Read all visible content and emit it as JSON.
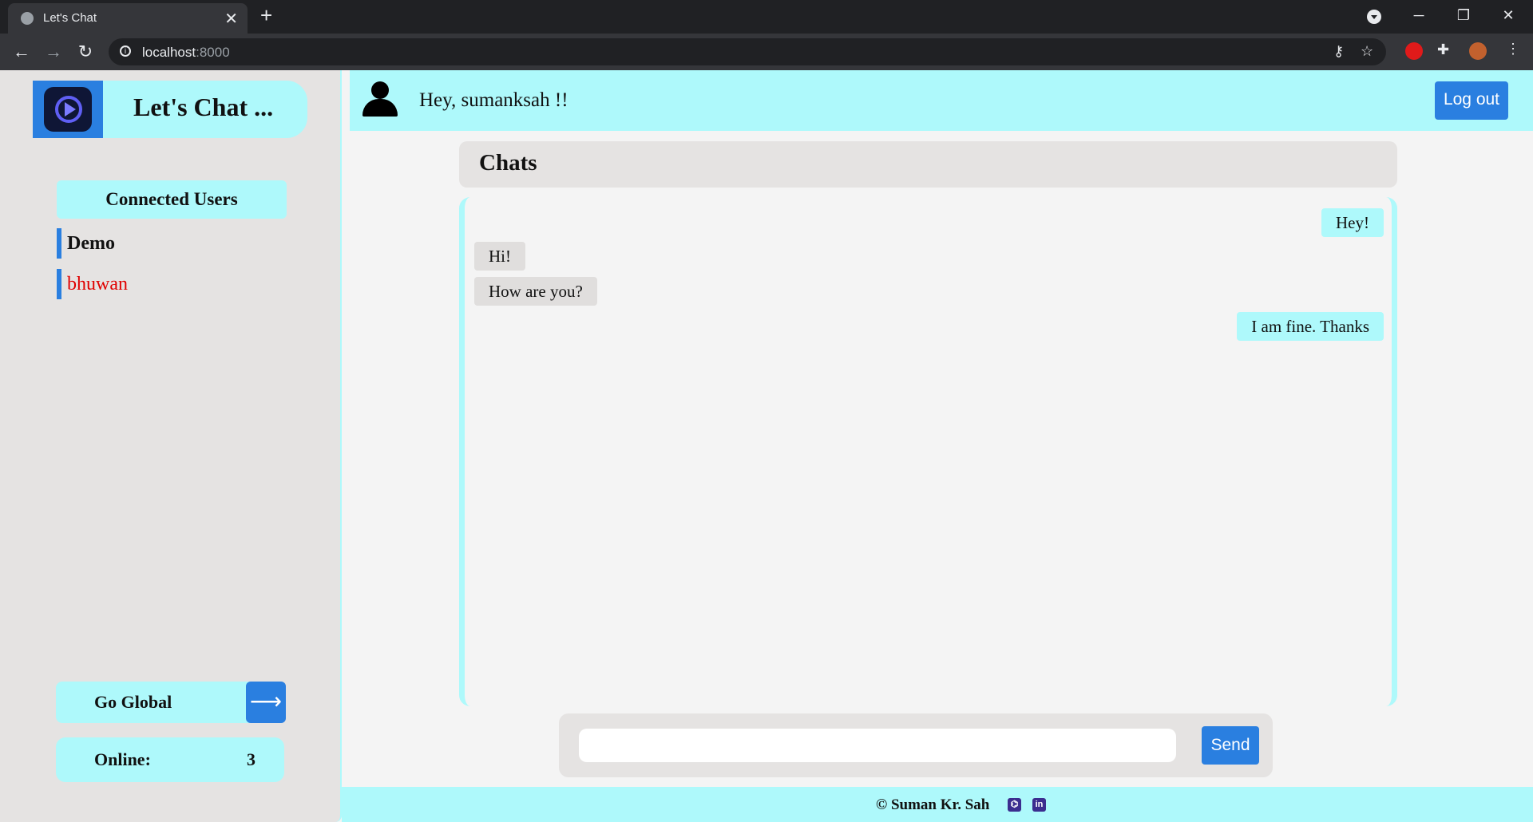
{
  "browser": {
    "tab_title": "Let's Chat",
    "tab_close": "✕",
    "new_tab": "+",
    "url_host": "localhost",
    "url_port": ":8000",
    "window_controls": {
      "minimize": "─",
      "maximize": "❐",
      "close": "✕"
    },
    "nav": {
      "back": "←",
      "forward": "→",
      "reload": "↻"
    },
    "icons": {
      "key": "key-icon",
      "star": "star-icon",
      "extensions": "puzzle-icon",
      "menu": "kebab-menu-icon"
    }
  },
  "app": {
    "brand_name": "Let's Chat ...",
    "greeting": "Hey, sumanksah !!",
    "logout_label": "Log out",
    "accent_color": "#2a7fe0",
    "highlight_color": "#aef9fb"
  },
  "sidebar": {
    "connected_users_title": "Connected Users",
    "users": [
      {
        "name": "Demo",
        "style": "bold"
      },
      {
        "name": "bhuwan",
        "style": "red"
      }
    ],
    "go_global_label": "Go Global",
    "go_global_arrow": "⟶",
    "online_label": "Online:",
    "online_count": "3"
  },
  "chat": {
    "title": "Chats",
    "messages": [
      {
        "text": "Hey!",
        "direction": "sent"
      },
      {
        "text": "Hi!",
        "direction": "recv"
      },
      {
        "text": "How are you?",
        "direction": "recv"
      },
      {
        "text": "I am fine. Thanks",
        "direction": "sent"
      }
    ],
    "input_value": "",
    "send_label": "Send"
  },
  "footer": {
    "text": "© Suman Kr. Sah",
    "github_icon": "github-icon",
    "linkedin_icon": "linkedin-icon",
    "linkedin_glyph": "in"
  }
}
